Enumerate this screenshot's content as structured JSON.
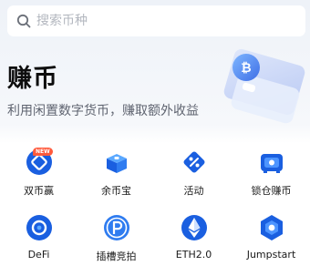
{
  "search": {
    "placeholder": "搜索币种"
  },
  "hero": {
    "title": "赚币",
    "subtitle": "利用闲置数字货币，赚取额外收益"
  },
  "grid": {
    "items": [
      {
        "label": "双币赢",
        "icon": "dual-currency-icon",
        "badge": "NEW"
      },
      {
        "label": "余币宝",
        "icon": "savings-box-icon"
      },
      {
        "label": "活动",
        "icon": "percent-tag-icon"
      },
      {
        "label": "锁仓赚币",
        "icon": "lock-vault-icon"
      },
      {
        "label": "DeFi",
        "icon": "defi-icon"
      },
      {
        "label": "插槽竞拍",
        "icon": "parachain-auction-icon"
      },
      {
        "label": "ETH2.0",
        "icon": "ethereum-icon"
      },
      {
        "label": "Jumpstart",
        "icon": "jumpstart-icon"
      }
    ]
  },
  "colors": {
    "accent": "#1a5fe0",
    "accent_light": "#5aa8ff",
    "badge": "#ff5a3c"
  }
}
